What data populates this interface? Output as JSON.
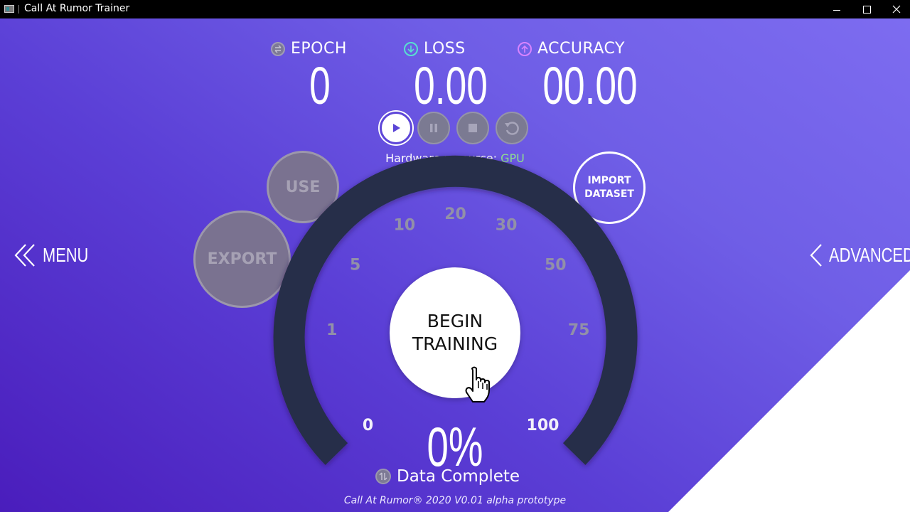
{
  "window": {
    "title": "Call At Rumor Trainer",
    "controls": [
      "minimize",
      "maximize",
      "close"
    ]
  },
  "stats": {
    "epoch": {
      "label": "EPOCH",
      "value": "0",
      "icon": "epoch-icon"
    },
    "loss": {
      "label": "LOSS",
      "value": "0.00",
      "icon": "arrow-down-circle-icon"
    },
    "accuracy": {
      "label": "ACCURACY",
      "value": "00.00",
      "icon": "arrow-up-circle-icon"
    }
  },
  "controls": {
    "play": {
      "icon": "play-icon",
      "state": "active"
    },
    "pause": {
      "icon": "pause-icon",
      "state": "disabled"
    },
    "stop": {
      "icon": "stop-icon",
      "state": "disabled"
    },
    "reset": {
      "icon": "reset-icon",
      "state": "disabled"
    }
  },
  "hardware": {
    "label": "Hardware resource: ",
    "value": "GPU"
  },
  "buttons": {
    "use": "USE",
    "export": "EXPORT",
    "import_line1": "IMPORT",
    "import_line2": "DATASET",
    "begin_line1": "BEGIN",
    "begin_line2": "TRAINING"
  },
  "nav": {
    "menu": "MENU",
    "advanced": "ADVANCED"
  },
  "gauge": {
    "ticks": [
      "0",
      "1",
      "5",
      "10",
      "20",
      "30",
      "50",
      "75",
      "100"
    ],
    "progress_percent": 0,
    "percent_text": "0%",
    "caption": "Data Complete"
  },
  "footer": "Call At Rumor® 2020 V0.01 alpha prototype",
  "colors": {
    "background_start": "#4a1dbc",
    "background_end": "#7d6cf0",
    "gauge_track": "#262d4a",
    "hardware_value": "#8fe08f",
    "loss_icon": "#58e0d0",
    "accuracy_icon": "#d884ff",
    "disabled_button": "#7a7290"
  }
}
